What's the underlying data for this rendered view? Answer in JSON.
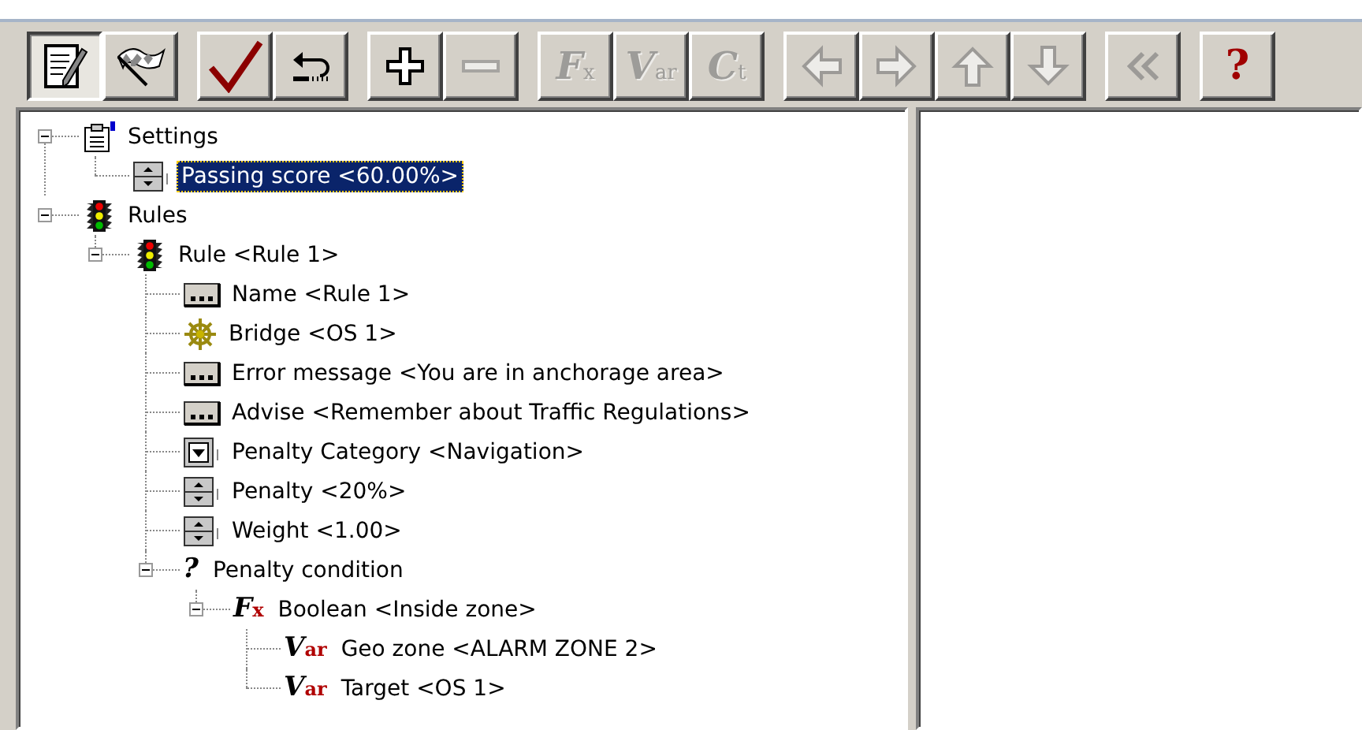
{
  "toolbar": [
    [
      {
        "kind": "edit",
        "pressed": true,
        "disabled": false
      },
      {
        "kind": "flag",
        "pressed": false,
        "disabled": false
      }
    ],
    [
      {
        "kind": "check",
        "pressed": false,
        "disabled": false
      },
      {
        "kind": "undo",
        "pressed": false,
        "disabled": false
      }
    ],
    [
      {
        "kind": "plus",
        "pressed": false,
        "disabled": false
      },
      {
        "kind": "minus",
        "pressed": false,
        "disabled": true
      }
    ],
    [
      {
        "kind": "glyph",
        "glyph": "F",
        "sub": "x",
        "pressed": false,
        "disabled": true
      },
      {
        "kind": "glyph",
        "glyph": "V",
        "sub": "ar",
        "pressed": false,
        "disabled": true
      },
      {
        "kind": "glyph",
        "glyph": "C",
        "sub": "t",
        "pressed": false,
        "disabled": true
      }
    ],
    [
      {
        "kind": "left",
        "pressed": false,
        "disabled": true
      },
      {
        "kind": "right",
        "pressed": false,
        "disabled": true
      },
      {
        "kind": "up",
        "pressed": false,
        "disabled": true
      },
      {
        "kind": "down",
        "pressed": false,
        "disabled": true
      }
    ],
    [
      {
        "kind": "rewind",
        "pressed": false,
        "disabled": true
      }
    ],
    [
      {
        "kind": "help",
        "glyph": "?",
        "pressed": false,
        "disabled": false
      }
    ]
  ],
  "tree": [
    {
      "label": "Settings",
      "kind": "settings",
      "selected": false,
      "expanded": true,
      "children": [
        {
          "label": "Passing score <60.00%>",
          "kind": "spinner",
          "selected": true
        }
      ]
    },
    {
      "label": "Rules",
      "kind": "traffic-light",
      "selected": false,
      "expanded": true,
      "children": [
        {
          "label": "Rule <Rule 1>",
          "kind": "traffic-light",
          "selected": false,
          "expanded": true,
          "children": [
            {
              "label": "Name <Rule 1>",
              "kind": "ellipsis",
              "selected": false
            },
            {
              "label": "Bridge <OS 1>",
              "kind": "helm",
              "selected": false
            },
            {
              "label": "Error message <You are in anchorage area>",
              "kind": "ellipsis",
              "selected": false
            },
            {
              "label": "Advise <Remember about Traffic Regulations>",
              "kind": "ellipsis",
              "selected": false
            },
            {
              "label": "Penalty Category <Navigation>",
              "kind": "dropdown",
              "selected": false
            },
            {
              "label": "Penalty <20%>",
              "kind": "spinner",
              "selected": false
            },
            {
              "label": "Weight <1.00>",
              "kind": "spinner",
              "selected": false
            },
            {
              "label": "Penalty condition",
              "kind": "glyph",
              "glyph": "?",
              "selected": false,
              "expanded": true,
              "children": [
                {
                  "label": "Boolean <Inside zone>",
                  "kind": "glyph",
                  "glyph": "F",
                  "sub": "x",
                  "selected": false,
                  "expanded": true,
                  "children": [
                    {
                      "label": "Geo zone <ALARM ZONE 2>",
                      "kind": "glyph",
                      "glyph": "V",
                      "sub": "ar",
                      "selected": false
                    },
                    {
                      "label": "Target <OS 1>",
                      "kind": "glyph",
                      "glyph": "V",
                      "sub": "ar",
                      "selected": false
                    }
                  ]
                }
              ]
            }
          ]
        }
      ]
    }
  ]
}
